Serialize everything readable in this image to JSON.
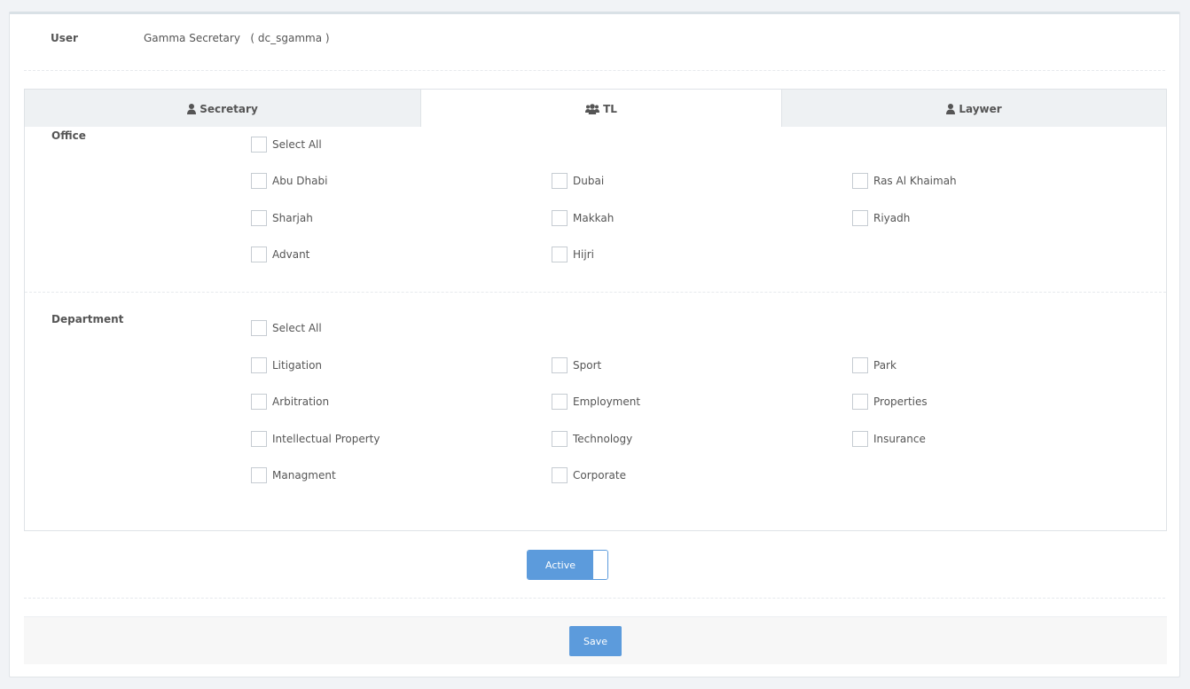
{
  "user": {
    "label": "User",
    "value": "Gamma Secretary   ( dc_sgamma )"
  },
  "tabs": [
    {
      "label": "Secretary",
      "icon": "user-icon",
      "active": false
    },
    {
      "label": "TL",
      "icon": "users-icon",
      "active": true
    },
    {
      "label": "Laywer",
      "icon": "user-icon",
      "active": false
    }
  ],
  "office": {
    "label": "Office",
    "select_all": "Select All",
    "items": [
      "Abu Dhabi",
      "Dubai",
      "Ras Al Khaimah",
      "Sharjah",
      "Makkah",
      "Riyadh",
      "Advant",
      "Hijri"
    ]
  },
  "department": {
    "label": "Department",
    "select_all": "Select All",
    "items": [
      "Litigation",
      "Sport",
      "Park",
      "Arbitration",
      "Employment",
      "Properties",
      "Intellectual Property",
      "Technology",
      "Insurance",
      "Managment",
      "Corporate"
    ]
  },
  "status_toggle": {
    "label": "Active",
    "on": true
  },
  "save_label": "Save",
  "colors": {
    "accent": "#5c9bdc",
    "tab_bg": "#eef1f3",
    "text": "#555555"
  }
}
